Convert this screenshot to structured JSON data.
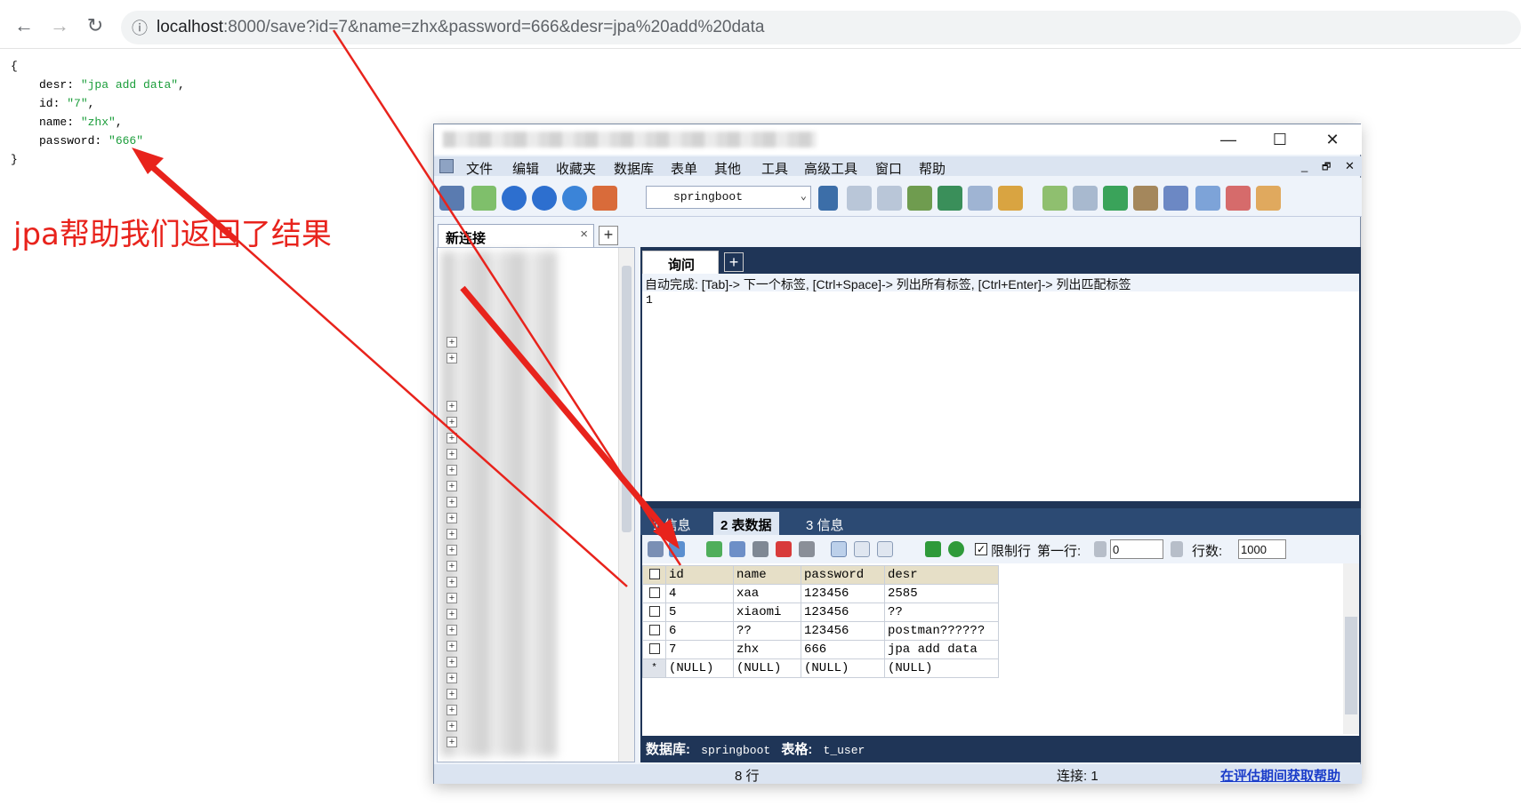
{
  "browser": {
    "url_host": "localhost",
    "url_rest": ":8000/save?id=7&name=zhx&password=666&desr=jpa%20add%20data",
    "back_icon": "←",
    "forward_icon": "→",
    "reload_icon": "↻",
    "info_icon": "ⓘ"
  },
  "json": {
    "open": "{",
    "close": "}",
    "rows": [
      {
        "key": "desr",
        "value": "\"jpa add data\"",
        "sep": ","
      },
      {
        "key": "id",
        "value": "\"7\"",
        "sep": ","
      },
      {
        "key": "name",
        "value": "\"zhx\"",
        "sep": ","
      },
      {
        "key": "password",
        "value": "\"666\"",
        "sep": ""
      }
    ]
  },
  "annotation": "jpa帮助我们返回了结果",
  "window": {
    "minimize": "—",
    "maximize": "☐",
    "close": "✕",
    "inner_min": "_",
    "inner_restore": "🗗",
    "inner_close": "✕"
  },
  "menu": [
    "文件",
    "编辑",
    "收藏夹",
    "数据库",
    "表单",
    "其他",
    "工具",
    "高级工具",
    "窗口",
    "帮助"
  ],
  "toolbar": {
    "db_selected": "springboot",
    "dropdown_icon": "⌄"
  },
  "connection_tab": {
    "label": "新连接",
    "close": "×"
  },
  "add_tab": "+",
  "query": {
    "tab_label": "询问",
    "hint": "自动完成: [Tab]-> 下一个标签, [Ctrl+Space]-> 列出所有标签, [Ctrl+Enter]-> 列出匹配标签",
    "line": "1"
  },
  "result_tabs": [
    {
      "label": "1 信息"
    },
    {
      "label": "2 表数据"
    },
    {
      "label": "3 信息"
    }
  ],
  "result_toolbar": {
    "limit_label": "限制行",
    "first_row_label": "第一行:",
    "first_row_value": "0",
    "rows_label": "行数:",
    "rows_value": "1000"
  },
  "table": {
    "columns": [
      "id",
      "name",
      "password",
      "desr"
    ],
    "rows": [
      [
        "4",
        "xaa",
        "123456",
        "2585"
      ],
      [
        "5",
        "xiaomi",
        "123456",
        "??"
      ],
      [
        "6",
        "??",
        "123456",
        "postman??????"
      ],
      [
        "7",
        "zhx",
        "666",
        "jpa add data"
      ],
      [
        "(NULL)",
        "(NULL)",
        "(NULL)",
        "(NULL)"
      ]
    ],
    "new_row_marker": "*"
  },
  "result_status": {
    "db_label": "数据库:",
    "db_value": "springboot",
    "table_label": "表格:",
    "table_value": "t_user"
  },
  "status": {
    "rows": "8 行",
    "connection": "连接: 1",
    "help": "在评估期间获取帮助"
  },
  "colors": {
    "annotation": "#e8231c",
    "accent": "#1f3557"
  }
}
